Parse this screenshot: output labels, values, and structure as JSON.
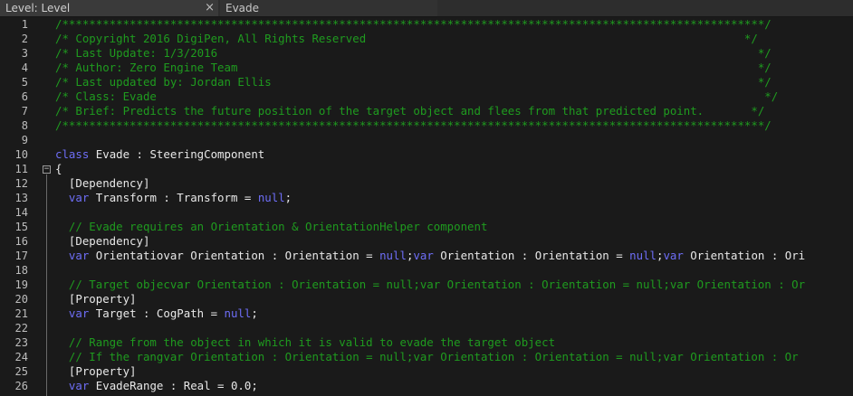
{
  "tabs": [
    {
      "label": "Level: Level",
      "close": "×"
    },
    {
      "label": "Evade"
    }
  ],
  "lines": [
    {
      "n": "1",
      "segs": [
        {
          "t": "/********************************************************************************************************/",
          "c": "comment"
        }
      ]
    },
    {
      "n": "2",
      "segs": [
        {
          "t": "/* Copyright 2016 DigiPen, All Rights Reserved                                                        */",
          "c": "comment"
        }
      ]
    },
    {
      "n": "3",
      "segs": [
        {
          "t": "/* Last Update: 1/3/2016                                                                                */",
          "c": "comment"
        }
      ]
    },
    {
      "n": "4",
      "segs": [
        {
          "t": "/* Author: Zero Engine Team                                                                             */",
          "c": "comment"
        }
      ]
    },
    {
      "n": "5",
      "segs": [
        {
          "t": "/* Last updated by: Jordan Ellis                                                                        */",
          "c": "comment"
        }
      ]
    },
    {
      "n": "6",
      "segs": [
        {
          "t": "/* Class: Evade                                                                                          */",
          "c": "comment"
        }
      ]
    },
    {
      "n": "7",
      "segs": [
        {
          "t": "/* Brief: Predicts the future position of the target object and flees from that predicted point.       */",
          "c": "comment"
        }
      ]
    },
    {
      "n": "8",
      "segs": [
        {
          "t": "/********************************************************************************************************/",
          "c": "comment"
        }
      ]
    },
    {
      "n": "9",
      "segs": []
    },
    {
      "n": "10",
      "segs": [
        {
          "t": "class",
          "c": "kw"
        },
        {
          "t": " Evade : SteeringComponent",
          "c": "text"
        }
      ]
    },
    {
      "n": "11",
      "segs": [
        {
          "t": "{",
          "c": "text"
        }
      ]
    },
    {
      "n": "12",
      "segs": [
        {
          "t": "  [Dependency]",
          "c": "text"
        }
      ]
    },
    {
      "n": "13",
      "segs": [
        {
          "t": "  ",
          "c": "text"
        },
        {
          "t": "var",
          "c": "kw"
        },
        {
          "t": " Transform : Transform = ",
          "c": "text"
        },
        {
          "t": "null",
          "c": "kw"
        },
        {
          "t": ";",
          "c": "text"
        }
      ]
    },
    {
      "n": "14",
      "segs": [
        {
          "t": "  ",
          "c": "text"
        }
      ]
    },
    {
      "n": "15",
      "segs": [
        {
          "t": "  // Evade requires an Orientation & OrientationHelper component",
          "c": "comment"
        }
      ]
    },
    {
      "n": "16",
      "segs": [
        {
          "t": "  [Dependency]",
          "c": "text"
        }
      ]
    },
    {
      "n": "17",
      "segs": [
        {
          "t": "  ",
          "c": "text"
        },
        {
          "t": "var",
          "c": "kw"
        },
        {
          "t": " Orientatiovar Orientation : Orientation = ",
          "c": "text"
        },
        {
          "t": "null",
          "c": "kw"
        },
        {
          "t": ";",
          "c": "text"
        },
        {
          "t": "var",
          "c": "kw"
        },
        {
          "t": " Orientation : Orientation = ",
          "c": "text"
        },
        {
          "t": "null",
          "c": "kw"
        },
        {
          "t": ";",
          "c": "text"
        },
        {
          "t": "var",
          "c": "kw"
        },
        {
          "t": " Orientation : Ori",
          "c": "text"
        }
      ]
    },
    {
      "n": "18",
      "segs": [
        {
          "t": "  ",
          "c": "text"
        }
      ]
    },
    {
      "n": "19",
      "segs": [
        {
          "t": "  // Target objecvar Orientation : Orientation = null;var Orientation : Orientation = null;var Orientation : Or",
          "c": "comment"
        }
      ]
    },
    {
      "n": "20",
      "segs": [
        {
          "t": "  [Property]",
          "c": "text"
        }
      ]
    },
    {
      "n": "21",
      "segs": [
        {
          "t": "  ",
          "c": "text"
        },
        {
          "t": "var",
          "c": "kw"
        },
        {
          "t": " Target : CogPath = ",
          "c": "text"
        },
        {
          "t": "null",
          "c": "kw"
        },
        {
          "t": ";",
          "c": "text"
        }
      ]
    },
    {
      "n": "22",
      "segs": [
        {
          "t": "  ",
          "c": "text"
        }
      ]
    },
    {
      "n": "23",
      "segs": [
        {
          "t": "  // Range from the object in which it is valid to evade the target object",
          "c": "comment"
        }
      ]
    },
    {
      "n": "24",
      "segs": [
        {
          "t": "  // If the rangvar Orientation : Orientation = null;var Orientation : Orientation = null;var Orientation : Or",
          "c": "comment"
        }
      ]
    },
    {
      "n": "25",
      "segs": [
        {
          "t": "  [Property]",
          "c": "text"
        }
      ]
    },
    {
      "n": "26",
      "segs": [
        {
          "t": "  ",
          "c": "text"
        },
        {
          "t": "var",
          "c": "kw"
        },
        {
          "t": " EvadeRange : Real = 0.0;",
          "c": "text"
        }
      ]
    }
  ]
}
